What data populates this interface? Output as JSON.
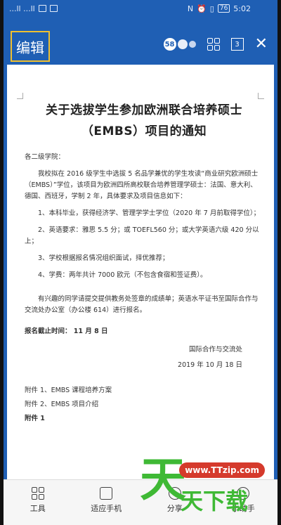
{
  "status_bar": {
    "signal": "...ll ...ll",
    "icons_right": [
      "N",
      "alarm",
      "vibrate"
    ],
    "battery": "76",
    "time": "5:02"
  },
  "toolbar": {
    "edit_label": "编辑",
    "badge_count": "58",
    "page_indicator": "3"
  },
  "document": {
    "title_line1": "关于选拔学生参加欧洲联合培养硕士",
    "title_line2": "（EMBS）项目的通知",
    "greeting": "各二级学院：",
    "intro": "我校拟在 2016 级学生中选拔 5 名品学兼优的学生攻读“商业研究欧洲硕士（EMBS）”学位，该项目为欧洲四所高校联合培养管理学硕士：法国、意大利、德国、西班牙，学制 2 年，具体要求及项目信息如下：",
    "req1": "1、本科毕业，获得经济学、管理学学士学位（2020 年 7 月前取得学位）；",
    "req2": "2、英语要求：雅思 5.5 分；或 TOEFL560 分；或大学英语六级 420 分以上；",
    "req3": "3、学校根据报名情况组织面试，择优推荐；",
    "req4": "4、学费：两年共计 7000 欧元（不包含食宿和签证费）。",
    "apply_text": "有兴趣的同学请提交提供教务处签章的成绩单；英语水平证书至国际合作与交流处办公室（办公楼 614）进行报名。",
    "deadline": "报名截止时间： 11 月 8 日",
    "org": "国际合作与交流处",
    "date": "2019 年 10 月 18 日",
    "attach1": "附件 1、EMBS 课程培养方案",
    "attach2": "附件 2、EMBS 项目介绍",
    "attach3": "附件 1"
  },
  "bottom_bar": {
    "item1": "工具",
    "item2": "适应手机",
    "item3": "分享",
    "item4": "小助手"
  },
  "watermark": {
    "url": "www.TTzip.com",
    "big": "天",
    "sub": "天下载"
  },
  "colors": {
    "toolbar": "#1f5fb4",
    "accent": "#f0c030",
    "watermark_green": "#3fb935",
    "watermark_red": "#d53a2c"
  }
}
